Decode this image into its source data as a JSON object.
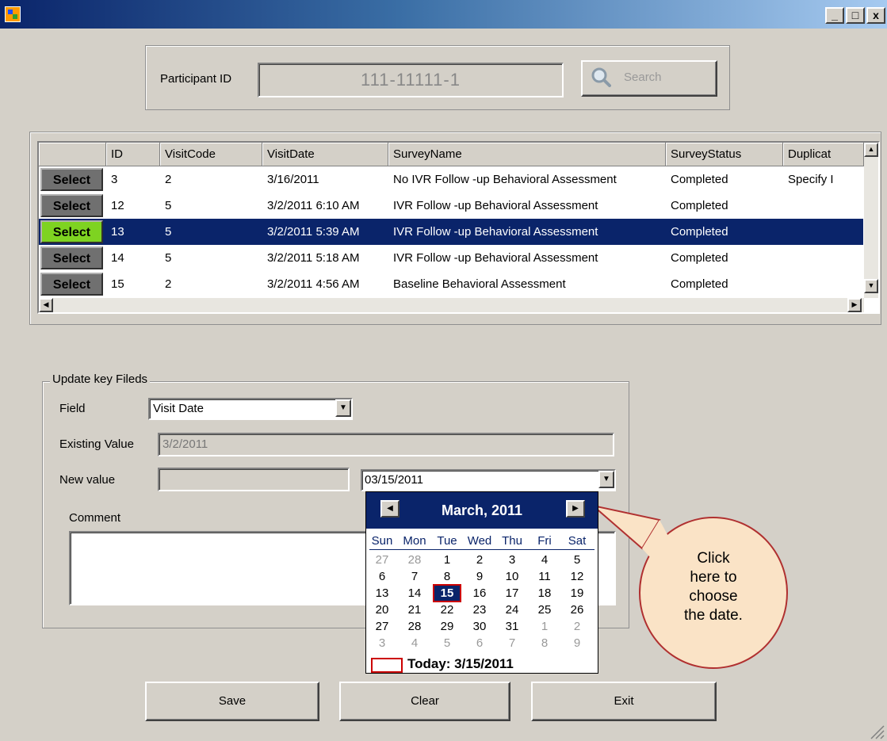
{
  "window": {
    "minimize_glyph": "_",
    "maximize_glyph": "□",
    "close_glyph": "x"
  },
  "participant": {
    "label": "Participant ID",
    "value": "111-11111-1",
    "search_label": "Search"
  },
  "grid": {
    "columns": [
      "ID",
      "VisitCode",
      "VisitDate",
      "SurveyName",
      "SurveyStatus",
      "Duplicat"
    ],
    "select_label": "Select",
    "rows": [
      {
        "id": "3",
        "visit_code": "2",
        "visit_date": "3/16/2011",
        "survey_name": "No IVR Follow -up Behavioral Assessment",
        "status": "Completed",
        "duplicate": "Specify I",
        "selected": false
      },
      {
        "id": "12",
        "visit_code": "5",
        "visit_date": "3/2/2011 6:10 AM",
        "survey_name": "IVR Follow -up Behavioral Assessment",
        "status": "Completed",
        "duplicate": "",
        "selected": false
      },
      {
        "id": "13",
        "visit_code": "5",
        "visit_date": "3/2/2011 5:39 AM",
        "survey_name": "IVR Follow -up Behavioral Assessment",
        "status": "Completed",
        "duplicate": "",
        "selected": true
      },
      {
        "id": "14",
        "visit_code": "5",
        "visit_date": "3/2/2011 5:18 AM",
        "survey_name": "IVR Follow -up Behavioral Assessment",
        "status": "Completed",
        "duplicate": "",
        "selected": false
      },
      {
        "id": "15",
        "visit_code": "2",
        "visit_date": "3/2/2011 4:56 AM",
        "survey_name": "Baseline Behavioral Assessment",
        "status": "Completed",
        "duplicate": "",
        "selected": false
      }
    ]
  },
  "update": {
    "legend": "Update key Fileds",
    "field_label": "Field",
    "field_value": "Visit Date",
    "existing_label": "Existing Value",
    "existing_value": "3/2/2011",
    "new_label": "New value",
    "new_value": "",
    "date_value": "03/15/2011",
    "comment_label": "Comment",
    "comment_value": ""
  },
  "calendar": {
    "title": "March, 2011",
    "weekdays": [
      "Sun",
      "Mon",
      "Tue",
      "Wed",
      "Thu",
      "Fri",
      "Sat"
    ],
    "weeks": [
      [
        "27",
        "28",
        "1",
        "2",
        "3",
        "4",
        "5"
      ],
      [
        "6",
        "7",
        "8",
        "9",
        "10",
        "11",
        "12"
      ],
      [
        "13",
        "14",
        "15",
        "16",
        "17",
        "18",
        "19"
      ],
      [
        "20",
        "21",
        "22",
        "23",
        "24",
        "25",
        "26"
      ],
      [
        "27",
        "28",
        "29",
        "30",
        "31",
        "1",
        "2"
      ],
      [
        "3",
        "4",
        "5",
        "6",
        "7",
        "8",
        "9"
      ]
    ],
    "selected_day": "15",
    "today_label": "Today: 3/15/2011"
  },
  "callout": {
    "text_lines": [
      "Click",
      "here to",
      "choose",
      "the date."
    ]
  },
  "buttons": {
    "save": "Save",
    "clear": "Clear",
    "exit": "Exit"
  },
  "colors": {
    "selection": "#0a246a",
    "active_select": "#7ed321",
    "callout_fill": "#fae3c6",
    "callout_border": "#b03030"
  }
}
